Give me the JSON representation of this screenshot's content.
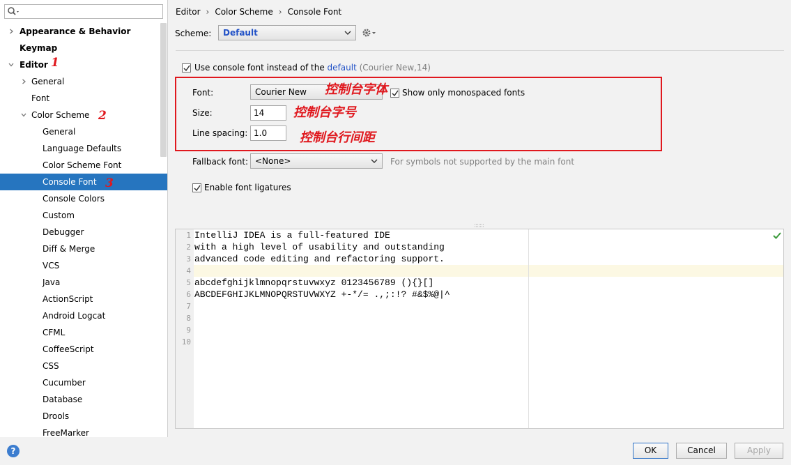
{
  "sidebar": {
    "search_placeholder": "",
    "items": [
      {
        "label": "Appearance & Behavior",
        "level": 0,
        "bold": true,
        "arrow": "right"
      },
      {
        "label": "Keymap",
        "level": 0,
        "bold": true,
        "arrow": "none"
      },
      {
        "label": "Editor",
        "level": 0,
        "bold": true,
        "arrow": "down"
      },
      {
        "label": "General",
        "level": 1,
        "bold": false,
        "arrow": "right"
      },
      {
        "label": "Font",
        "level": 1,
        "bold": false,
        "arrow": "none"
      },
      {
        "label": "Color Scheme",
        "level": 1,
        "bold": false,
        "arrow": "down"
      },
      {
        "label": "General",
        "level": 2,
        "bold": false,
        "arrow": "none"
      },
      {
        "label": "Language Defaults",
        "level": 2,
        "bold": false,
        "arrow": "none"
      },
      {
        "label": "Color Scheme Font",
        "level": 2,
        "bold": false,
        "arrow": "none"
      },
      {
        "label": "Console Font",
        "level": 2,
        "bold": false,
        "arrow": "none",
        "selected": true
      },
      {
        "label": "Console Colors",
        "level": 2,
        "bold": false,
        "arrow": "none"
      },
      {
        "label": "Custom",
        "level": 2,
        "bold": false,
        "arrow": "none"
      },
      {
        "label": "Debugger",
        "level": 2,
        "bold": false,
        "arrow": "none"
      },
      {
        "label": "Diff & Merge",
        "level": 2,
        "bold": false,
        "arrow": "none"
      },
      {
        "label": "VCS",
        "level": 2,
        "bold": false,
        "arrow": "none"
      },
      {
        "label": "Java",
        "level": 2,
        "bold": false,
        "arrow": "none"
      },
      {
        "label": "ActionScript",
        "level": 2,
        "bold": false,
        "arrow": "none"
      },
      {
        "label": "Android Logcat",
        "level": 2,
        "bold": false,
        "arrow": "none"
      },
      {
        "label": "CFML",
        "level": 2,
        "bold": false,
        "arrow": "none"
      },
      {
        "label": "CoffeeScript",
        "level": 2,
        "bold": false,
        "arrow": "none"
      },
      {
        "label": "CSS",
        "level": 2,
        "bold": false,
        "arrow": "none"
      },
      {
        "label": "Cucumber",
        "level": 2,
        "bold": false,
        "arrow": "none"
      },
      {
        "label": "Database",
        "level": 2,
        "bold": false,
        "arrow": "none"
      },
      {
        "label": "Drools",
        "level": 2,
        "bold": false,
        "arrow": "none"
      },
      {
        "label": "FreeMarker",
        "level": 2,
        "bold": false,
        "arrow": "none"
      }
    ]
  },
  "annotations": {
    "num1": "1",
    "num2": "2",
    "num3": "3",
    "font_note": "控制台字体",
    "size_note": "控制台字号",
    "spacing_note": "控制台行间距"
  },
  "breadcrumb": [
    "Editor",
    "Color Scheme",
    "Console Font"
  ],
  "scheme": {
    "label": "Scheme:",
    "value": "Default"
  },
  "use_console_font": {
    "checked": true,
    "text_before": "Use console font instead of the ",
    "link": "default",
    "text_after": " (Courier New,14)"
  },
  "font_settings": {
    "font_label": "Font:",
    "font_value": "Courier New",
    "monospace_label": "Show only monospaced fonts",
    "monospace_checked": true,
    "size_label": "Size:",
    "size_value": "14",
    "spacing_label": "Line spacing:",
    "spacing_value": "1.0"
  },
  "fallback": {
    "label": "Fallback font:",
    "value": "<None>",
    "hint": "For symbols not supported by the main font"
  },
  "ligatures": {
    "checked": true,
    "label": "Enable font ligatures"
  },
  "preview": {
    "lines": [
      "IntelliJ IDEA is a full-featured IDE",
      "with a high level of usability and outstanding",
      "advanced code editing and refactoring support.",
      "",
      "abcdefghijklmnopqrstuvwxyz 0123456789 (){}[]",
      "ABCDEFGHIJKLMNOPQRSTUVWXYZ +-*/= .,;:!? #&$%@|^",
      "",
      "",
      "",
      ""
    ],
    "line_numbers": [
      "1",
      "2",
      "3",
      "4",
      "5",
      "6",
      "7",
      "8",
      "9",
      "10"
    ]
  },
  "buttons": {
    "help": "?",
    "ok": "OK",
    "cancel": "Cancel",
    "apply": "Apply"
  },
  "colors": {
    "selection": "#2675bf",
    "link": "#2252c7",
    "annotation": "#e0181e"
  }
}
